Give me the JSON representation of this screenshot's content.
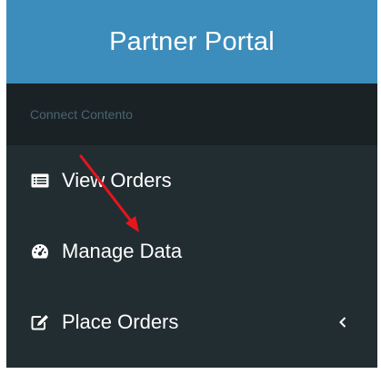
{
  "header": {
    "title": "Partner Portal"
  },
  "sidebar": {
    "section_label": "Connect Contento",
    "items": [
      {
        "label": "View Orders",
        "icon": "list-alt-icon"
      },
      {
        "label": "Manage Data",
        "icon": "dashboard-icon"
      },
      {
        "label": "Place Orders",
        "icon": "edit-icon",
        "chevron": "chevron-left-icon"
      }
    ]
  },
  "colors": {
    "header_bg": "#3c8dbc",
    "sidebar_bg": "#222d32",
    "section_bg": "#1a2226",
    "section_text": "#4b646f",
    "annotation_arrow": "#e8141c"
  }
}
